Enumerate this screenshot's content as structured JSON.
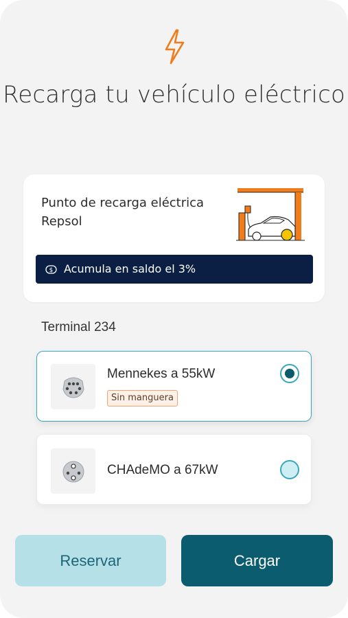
{
  "header": {
    "icon": "lightning-bolt-icon",
    "title": "Recarga tu vehículo eléctrico"
  },
  "station_card": {
    "title": "Punto de recarga eléctrica Repsol",
    "illustration": "charging-station-car-illustration",
    "banner_icon": "cashback-icon",
    "banner_text": "Acumula en saldo el 3%"
  },
  "terminal": {
    "label": "Terminal 234"
  },
  "options": [
    {
      "label": "Mennekes a 55kW",
      "tag": "Sin manguera",
      "icon": "mennekes-connector-icon",
      "selected": true
    },
    {
      "label": "CHAdeMO a 67kW",
      "icon": "chademo-connector-icon",
      "selected": false
    }
  ],
  "actions": {
    "reserve_label": "Reservar",
    "charge_label": "Cargar"
  },
  "colors": {
    "accent_orange": "#f07c1b",
    "navy": "#0b1f45",
    "teal_dark": "#0b5c6e",
    "teal_light": "#b5e0e8",
    "teal_border": "#3aa6bd"
  }
}
